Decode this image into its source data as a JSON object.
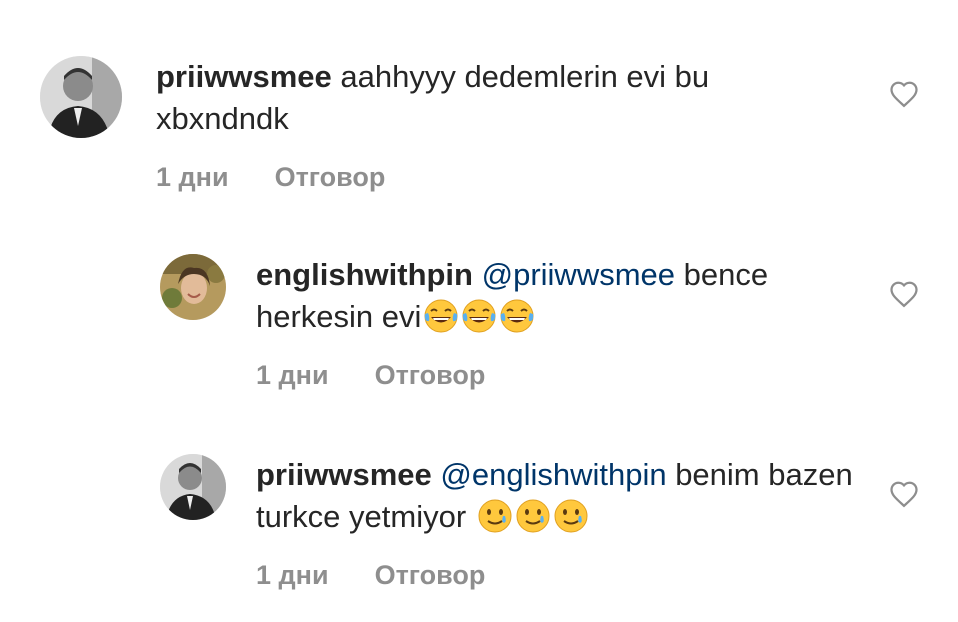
{
  "comments": [
    {
      "username": "priiwwsmee",
      "mention": "",
      "text": " aahhyyy dedemlerin evi bu xbxndndk",
      "emoji": [],
      "time": "1 дни",
      "reply_label": "Отговор",
      "avatar": "man-in-suit-avatar"
    },
    {
      "username": "englishwithpin",
      "mention": "@priiwwsmee",
      "text": " bence herkesin evi",
      "emoji": [
        "😂",
        "😂",
        "😂"
      ],
      "time": "1 дни",
      "reply_label": "Отговор",
      "avatar": "smiling-woman-avatar"
    },
    {
      "username": "priiwwsmee",
      "mention": "@englishwithpin",
      "text": " benim bazen turkce yetmiyor ",
      "emoji": [
        "🥲",
        "🥲",
        "🥲"
      ],
      "time": "1 дни",
      "reply_label": "Отговор",
      "avatar": "man-in-suit-avatar"
    }
  ],
  "icons": {
    "like": "heart-outline-icon"
  },
  "colors": {
    "text": "#262626",
    "mention": "#003569",
    "meta": "#8e8e8e"
  }
}
